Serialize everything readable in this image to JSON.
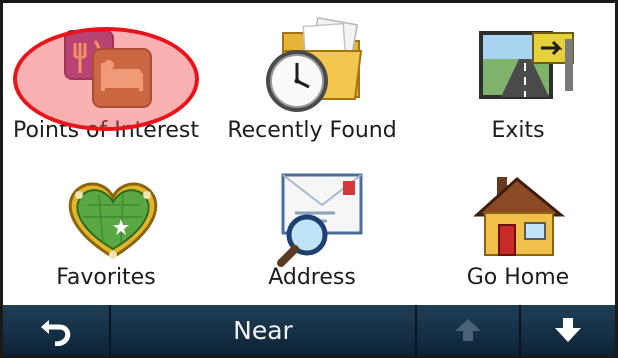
{
  "menu": {
    "items": [
      {
        "label": "Points of Interest",
        "icon": "points-of-interest-icon"
      },
      {
        "label": "Recently Found",
        "icon": "recently-found-clock-icon"
      },
      {
        "label": "Exits",
        "icon": "exits-road-sign-icon"
      },
      {
        "label": "Favorites",
        "icon": "favorites-heart-map-icon"
      },
      {
        "label": "Address",
        "icon": "address-envelope-magnifier-icon"
      },
      {
        "label": "Go Home",
        "icon": "go-home-house-icon"
      }
    ]
  },
  "bottom_bar": {
    "back_icon": "back-arrow-icon",
    "near_label": "Near",
    "up_icon": "scroll-up-arrow-icon",
    "up_enabled": false,
    "down_icon": "scroll-down-arrow-icon"
  },
  "colors": {
    "highlight": "#e8141a",
    "bar_background": "#143047",
    "up_arrow_disabled": "#4a6273",
    "down_arrow": "#ffffff"
  }
}
